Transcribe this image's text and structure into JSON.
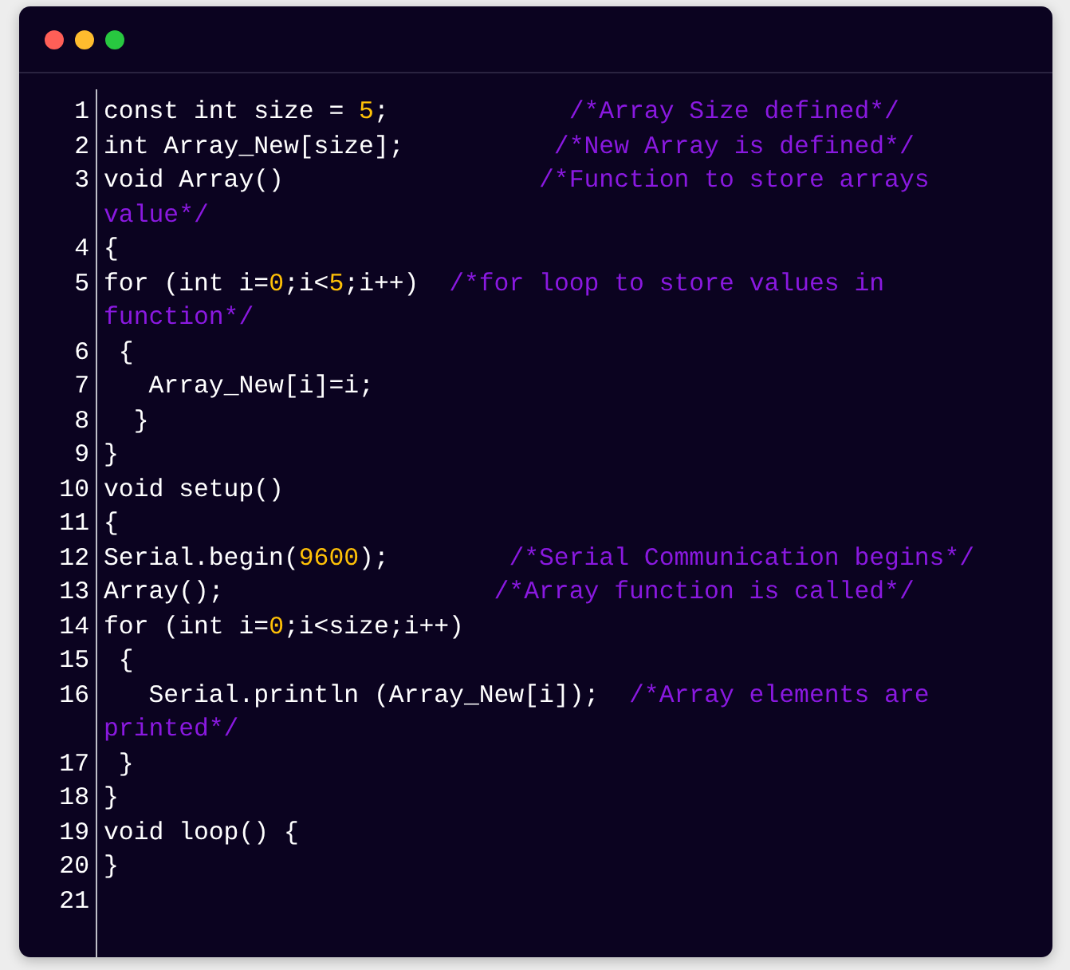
{
  "code_lines": [
    {
      "number": "1",
      "tokens": [
        {
          "kind": "code",
          "text": "const int size = "
        },
        {
          "kind": "number",
          "text": "5"
        },
        {
          "kind": "code",
          "text": ";            "
        },
        {
          "kind": "comment",
          "text": "/*Array Size defined*/"
        }
      ]
    },
    {
      "number": "2",
      "tokens": [
        {
          "kind": "code",
          "text": "int Array_New[size];          "
        },
        {
          "kind": "comment",
          "text": "/*New Array is defined*/"
        }
      ]
    },
    {
      "number": "3",
      "tokens": [
        {
          "kind": "code",
          "text": "void Array()                 "
        },
        {
          "kind": "comment",
          "text": "/*Function to store arrays value*/"
        }
      ]
    },
    {
      "number": "4",
      "tokens": [
        {
          "kind": "code",
          "text": "{"
        }
      ]
    },
    {
      "number": "5",
      "tokens": [
        {
          "kind": "code",
          "text": "for (int i="
        },
        {
          "kind": "number",
          "text": "0"
        },
        {
          "kind": "code",
          "text": ";i<"
        },
        {
          "kind": "number",
          "text": "5"
        },
        {
          "kind": "code",
          "text": ";i++)  "
        },
        {
          "kind": "comment",
          "text": "/*for loop to store values in function*/"
        }
      ]
    },
    {
      "number": "6",
      "tokens": [
        {
          "kind": "code",
          "text": " {"
        }
      ]
    },
    {
      "number": "7",
      "tokens": [
        {
          "kind": "code",
          "text": "   Array_New[i]=i;"
        }
      ]
    },
    {
      "number": "8",
      "tokens": [
        {
          "kind": "code",
          "text": "  }"
        }
      ]
    },
    {
      "number": "9",
      "tokens": [
        {
          "kind": "code",
          "text": "}"
        }
      ]
    },
    {
      "number": "10",
      "tokens": [
        {
          "kind": "code",
          "text": "void setup()"
        }
      ]
    },
    {
      "number": "11",
      "tokens": [
        {
          "kind": "code",
          "text": "{"
        }
      ]
    },
    {
      "number": "12",
      "tokens": [
        {
          "kind": "code",
          "text": "Serial.begin("
        },
        {
          "kind": "number",
          "text": "9600"
        },
        {
          "kind": "code",
          "text": ");        "
        },
        {
          "kind": "comment",
          "text": "/*Serial Communication begins*/"
        }
      ]
    },
    {
      "number": "13",
      "tokens": [
        {
          "kind": "code",
          "text": "Array();                  "
        },
        {
          "kind": "comment",
          "text": "/*Array function is called*/"
        }
      ]
    },
    {
      "number": "14",
      "tokens": [
        {
          "kind": "code",
          "text": "for (int i="
        },
        {
          "kind": "number",
          "text": "0"
        },
        {
          "kind": "code",
          "text": ";i<size;i++)"
        }
      ]
    },
    {
      "number": "15",
      "tokens": [
        {
          "kind": "code",
          "text": " {"
        }
      ]
    },
    {
      "number": "16",
      "tokens": [
        {
          "kind": "code",
          "text": "   Serial.println (Array_New[i]);  "
        },
        {
          "kind": "comment",
          "text": "/*Array elements are printed*/"
        }
      ]
    },
    {
      "number": "17",
      "tokens": [
        {
          "kind": "code",
          "text": " }"
        }
      ]
    },
    {
      "number": "18",
      "tokens": [
        {
          "kind": "code",
          "text": "}"
        }
      ]
    },
    {
      "number": "19",
      "tokens": [
        {
          "kind": "code",
          "text": "void loop() {"
        }
      ]
    },
    {
      "number": "20",
      "tokens": [
        {
          "kind": "code",
          "text": "}"
        }
      ]
    },
    {
      "number": "21"
    }
  ]
}
